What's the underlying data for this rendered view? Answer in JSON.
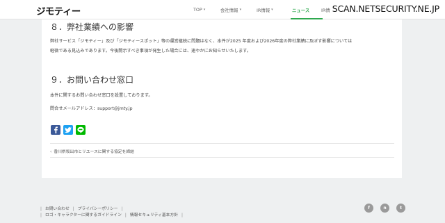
{
  "header": {
    "logo_text": "ジモティー",
    "nav": [
      {
        "label": "TOP",
        "has_dropdown": true
      },
      {
        "label": "会社情報",
        "has_dropdown": true
      },
      {
        "label": "IR情報",
        "has_dropdown": true
      },
      {
        "label": "ニュース",
        "has_dropdown": false,
        "active": true
      },
      {
        "label": "IR情",
        "has_dropdown": false
      }
    ],
    "caret": "▾",
    "watermark": "SCAN.NETSECURITY.NE.JP"
  },
  "section8": {
    "heading": "８．弊社業績への影響",
    "line1": "弊社サービス「ジモティー」及び「ジモティースポット」等の運営継続に問題はなく、本件が2025 年度および2026年度の弊社業績に及ぼす影響については",
    "line2": "軽微である見込みであります。今後開示すべき事項が発生した場合には、速やかにお知らせいたします。"
  },
  "section9": {
    "heading": "９．お問い合わせ窓口",
    "line1": "本件に関するお問い合わせ窓口を設置しております。",
    "line2": "問合せメールアドレス：support@jmty.jp"
  },
  "share": {
    "facebook_icon": "facebook-icon",
    "twitter_icon": "twitter-icon",
    "line_icon": "line-icon"
  },
  "prev_article": {
    "arrow": "‹",
    "title": "香川県坂出市とリユースに関する協定を締結"
  },
  "footer": {
    "links_row1": [
      "お問い合わせ",
      "プライバシーポリシー"
    ],
    "links_row2": [
      "ロゴ・キャラクターに関するガイドライン",
      "情報セキュリティ基本方針"
    ],
    "separator": "|",
    "social": [
      {
        "icon": "facebook-icon",
        "glyph": "f"
      },
      {
        "icon": "note-icon",
        "glyph": "n"
      },
      {
        "icon": "twitter-icon",
        "glyph": "t"
      }
    ]
  },
  "colors": {
    "brand_green": "#2fa84f",
    "facebook": "#3b5998",
    "twitter": "#1da1f2",
    "line": "#00b900",
    "page_bg": "#eef0f1"
  }
}
